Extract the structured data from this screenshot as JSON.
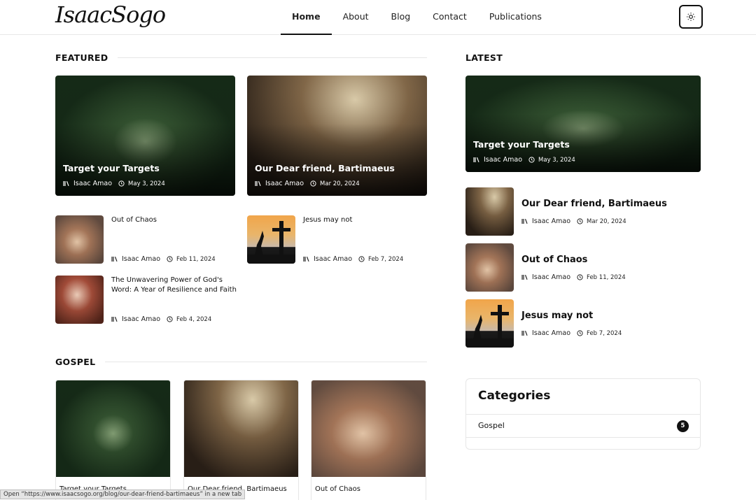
{
  "header": {
    "logo": "IsaacSogo",
    "nav": [
      {
        "label": "Home",
        "active": true
      },
      {
        "label": "About"
      },
      {
        "label": "Blog"
      },
      {
        "label": "Contact"
      },
      {
        "label": "Publications"
      }
    ],
    "theme_icon": "sun-icon"
  },
  "sections": {
    "featured": "FEATURED",
    "latest": "LATEST",
    "gospel": "GOSPEL"
  },
  "featured": {
    "cards": [
      {
        "title": "Target your Targets",
        "author": "Isaac Amao",
        "date": "May 3, 2024"
      },
      {
        "title": "Our Dear friend, Bartimaeus",
        "author": "Isaac Amao",
        "date": "Mar 20, 2024"
      }
    ],
    "list": [
      {
        "title": "Out of Chaos",
        "author": "Isaac Amao",
        "date": "Feb 11, 2024"
      },
      {
        "title": "Jesus may not",
        "author": "Isaac Amao",
        "date": "Feb 7, 2024"
      },
      {
        "title": "The Unwavering Power of God's Word: A Year of Resilience and Faith",
        "author": "Isaac Amao",
        "date": "Feb 4, 2024"
      }
    ]
  },
  "latest": {
    "hero": {
      "title": "Target your Targets",
      "author": "Isaac Amao",
      "date": "May 3, 2024"
    },
    "items": [
      {
        "title": "Our Dear friend, Bartimaeus",
        "author": "Isaac Amao",
        "date": "Mar 20, 2024"
      },
      {
        "title": "Out of Chaos",
        "author": "Isaac Amao",
        "date": "Feb 11, 2024"
      },
      {
        "title": "Jesus may not",
        "author": "Isaac Amao",
        "date": "Feb 7, 2024"
      }
    ]
  },
  "categories": {
    "title": "Categories",
    "items": [
      {
        "name": "Gospel",
        "count": "5"
      }
    ]
  },
  "gospel": {
    "cards": [
      {
        "title": "Target your Targets"
      },
      {
        "title": "Our Dear friend, Bartimaeus"
      },
      {
        "title": "Out of Chaos"
      }
    ]
  },
  "status_bar": "Open “https://www.isaacsogo.org/blog/our-dear-friend-bartimaeus” in a new tab",
  "icons": {
    "author": "books-icon",
    "date": "clock-icon"
  }
}
